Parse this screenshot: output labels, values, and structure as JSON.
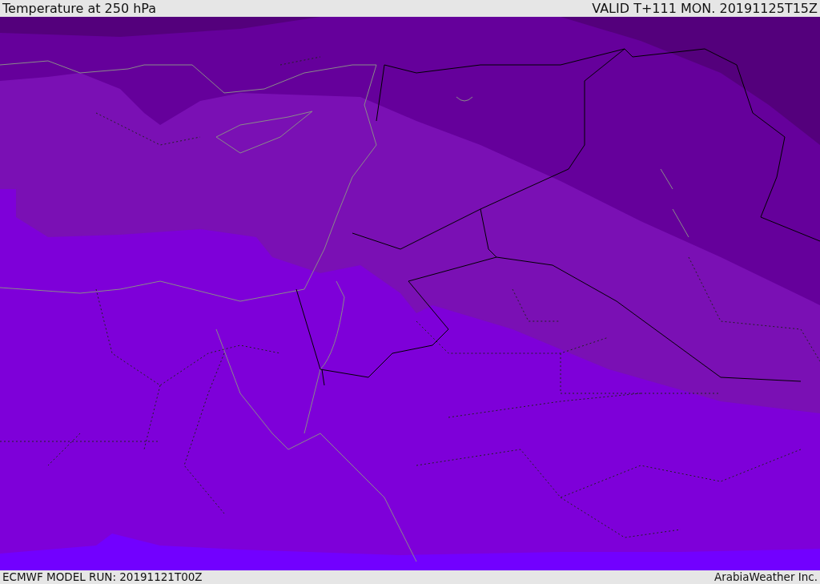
{
  "header": {
    "title": "Temperature at 250 hPa",
    "valid": "VALID T+111 MON. 20191125T15Z"
  },
  "footer": {
    "model_run": "ECMWF MODEL RUN: 20191121T00Z",
    "credit": "ArabiaWeather Inc."
  }
}
